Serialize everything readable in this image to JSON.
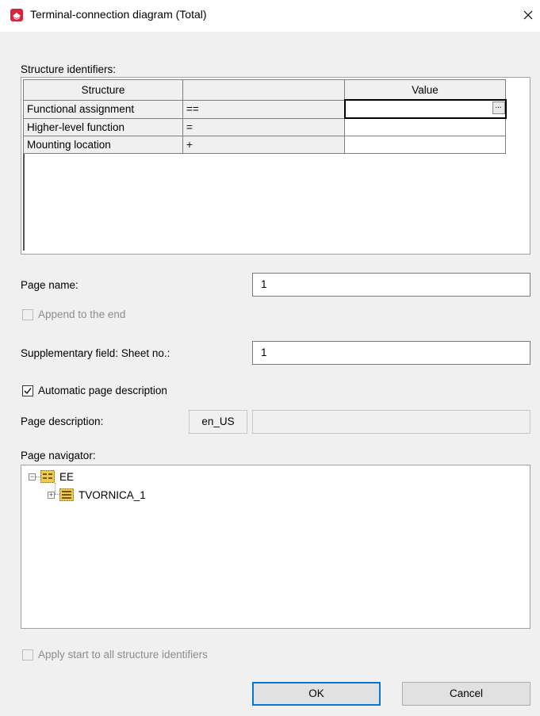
{
  "window": {
    "title": "Terminal-connection diagram (Total)",
    "close_glyph": "✕"
  },
  "structure": {
    "label": "Structure identifiers:",
    "columns": [
      "Structure",
      "",
      "Value"
    ],
    "rows": [
      {
        "name": "Functional assignment",
        "prefix": "==",
        "value": ""
      },
      {
        "name": "Higher-level function",
        "prefix": "=",
        "value": ""
      },
      {
        "name": "Mounting location",
        "prefix": "+",
        "value": ""
      }
    ],
    "ellipsis_label": "..."
  },
  "page_name": {
    "label": "Page name:",
    "value": "1"
  },
  "append_to_end": {
    "label": "Append to the end",
    "checked": false,
    "enabled": false
  },
  "sheet_no": {
    "label": "Supplementary field: Sheet no.:",
    "value": "1"
  },
  "auto_page_description": {
    "label": "Automatic page description",
    "checked": true
  },
  "page_description": {
    "label": "Page description:",
    "language": "en_US",
    "value": ""
  },
  "navigator": {
    "label": "Page navigator:",
    "nodes": [
      {
        "label": "EE",
        "expanded": true,
        "icon": "structure-icon"
      },
      {
        "label": "TVORNICA_1",
        "expanded": false,
        "icon": "structure-icon"
      }
    ]
  },
  "apply_start": {
    "label": "Apply start to all structure identifiers",
    "checked": false,
    "enabled": false
  },
  "buttons": {
    "ok": "OK",
    "cancel": "Cancel"
  },
  "colors": {
    "accent": "#0078d7",
    "app_icon": "#d6263a",
    "folder_yellow": "#f2c94c"
  }
}
